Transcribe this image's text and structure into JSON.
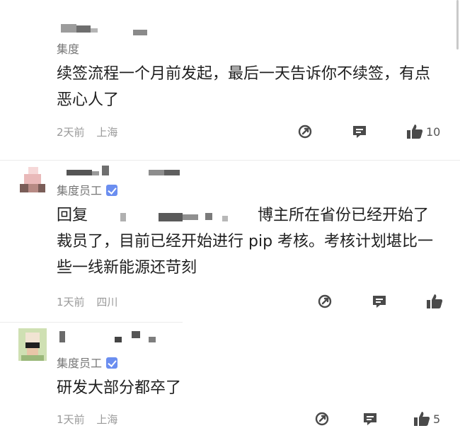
{
  "comments": [
    {
      "company": "集度",
      "verified": false,
      "text": "续签流程一个月前发起，最后一天告诉你不续签，有点恶心人了",
      "time": "2天前",
      "location": "上海",
      "likes": "10"
    },
    {
      "company": "集度员工",
      "verified": true,
      "reply_prefix": "回复",
      "text": "博主所在省份已经开始了裁员了，目前已经开始进行 pip 考核。考核计划堪比一些一线新能源还苛刻",
      "time": "1天前",
      "location": "四川",
      "likes": ""
    },
    {
      "company": "集度员工",
      "verified": true,
      "text": "研发大部分都卒了",
      "time": "1天前",
      "location": "上海",
      "likes": "5"
    }
  ],
  "icons": {
    "share": "share-icon",
    "reply": "comment-icon",
    "like": "thumbs-up-icon"
  },
  "colors": {
    "badge": "#6b8ef0",
    "icon": "#4a4a4a",
    "meta": "#9a9a9a"
  }
}
